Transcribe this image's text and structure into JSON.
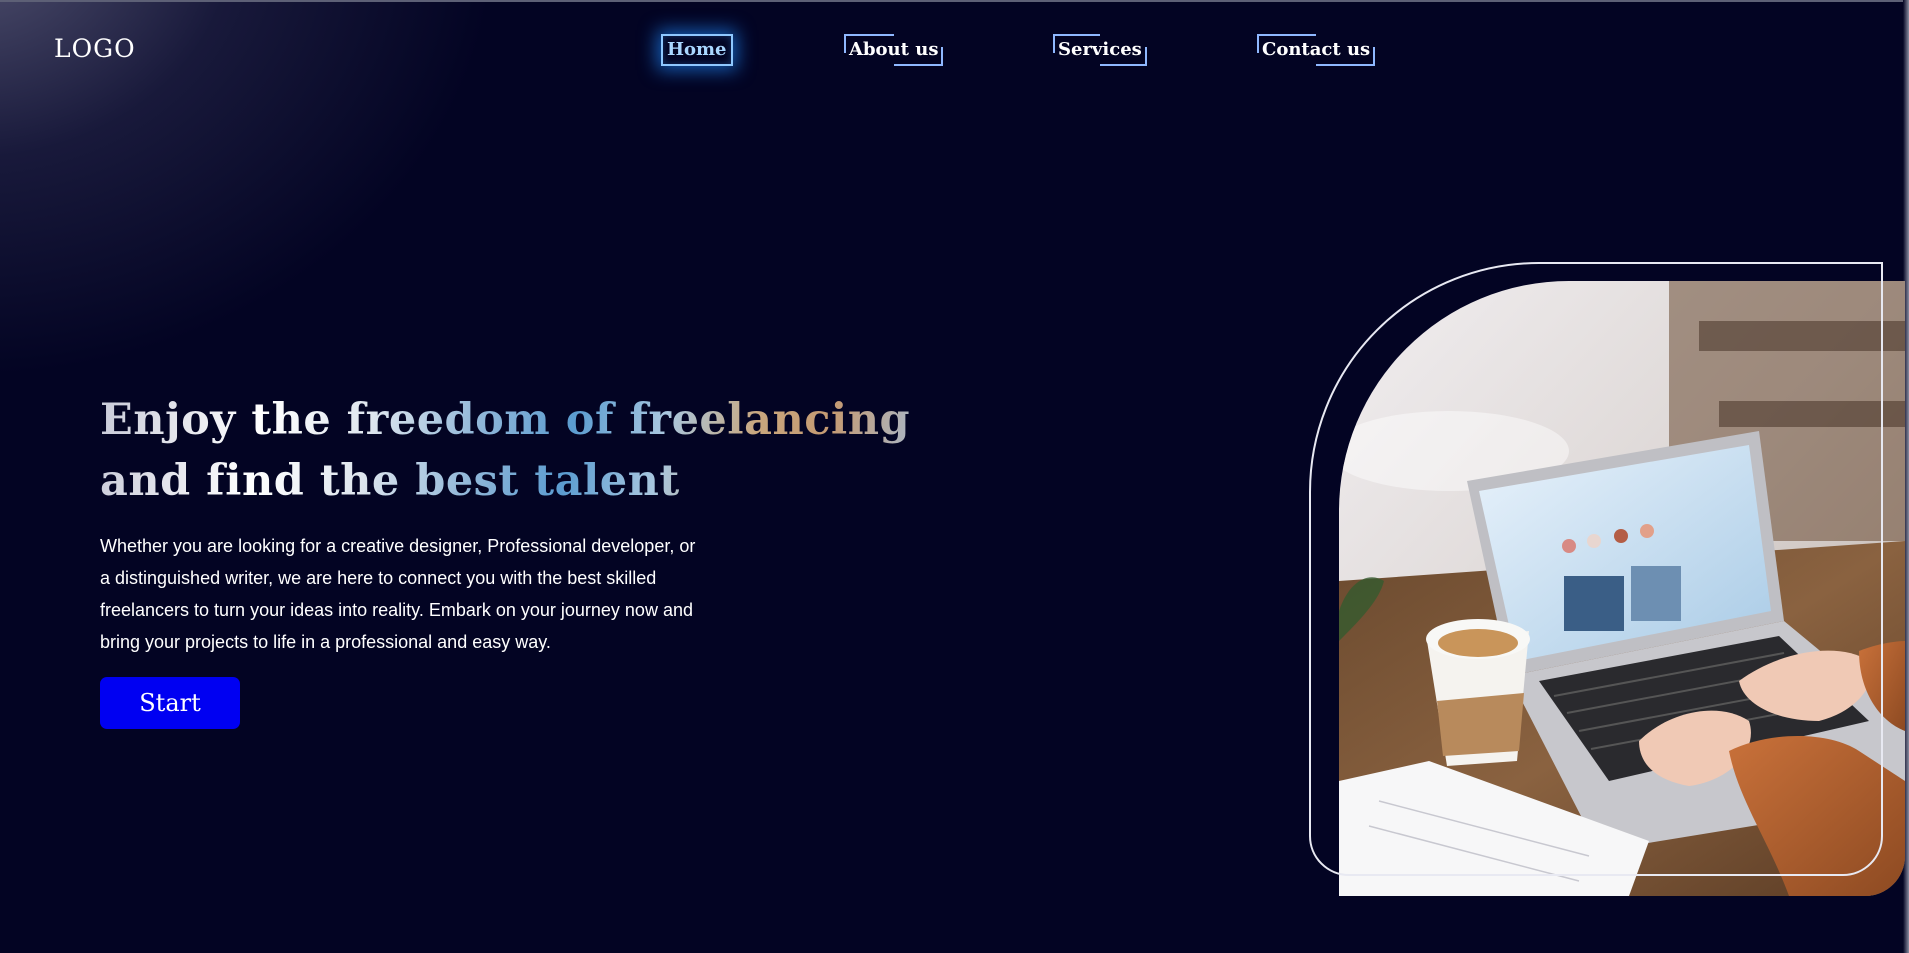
{
  "header": {
    "logo": "LOGO",
    "nav": [
      {
        "label": "Home",
        "active": true
      },
      {
        "label": "About us",
        "active": false
      },
      {
        "label": "Services",
        "active": false
      },
      {
        "label": "Contact us",
        "active": false
      }
    ]
  },
  "hero": {
    "title": "Enjoy the freedom of freelancing and find the best talent",
    "description": "Whether you are looking for a creative designer, Professional developer, or a distinguished writer, we are here to connect you with the best skilled freelancers to turn your ideas into reality. Embark on your journey now and bring your projects to life in a professional and easy way.",
    "cta_label": "Start"
  },
  "colors": {
    "background": "#030423",
    "accent_blue": "#0000f2",
    "nav_border": "#8fb8ff",
    "text": "#ffffff"
  },
  "image": {
    "icon": "laptop-coffee-photo"
  }
}
